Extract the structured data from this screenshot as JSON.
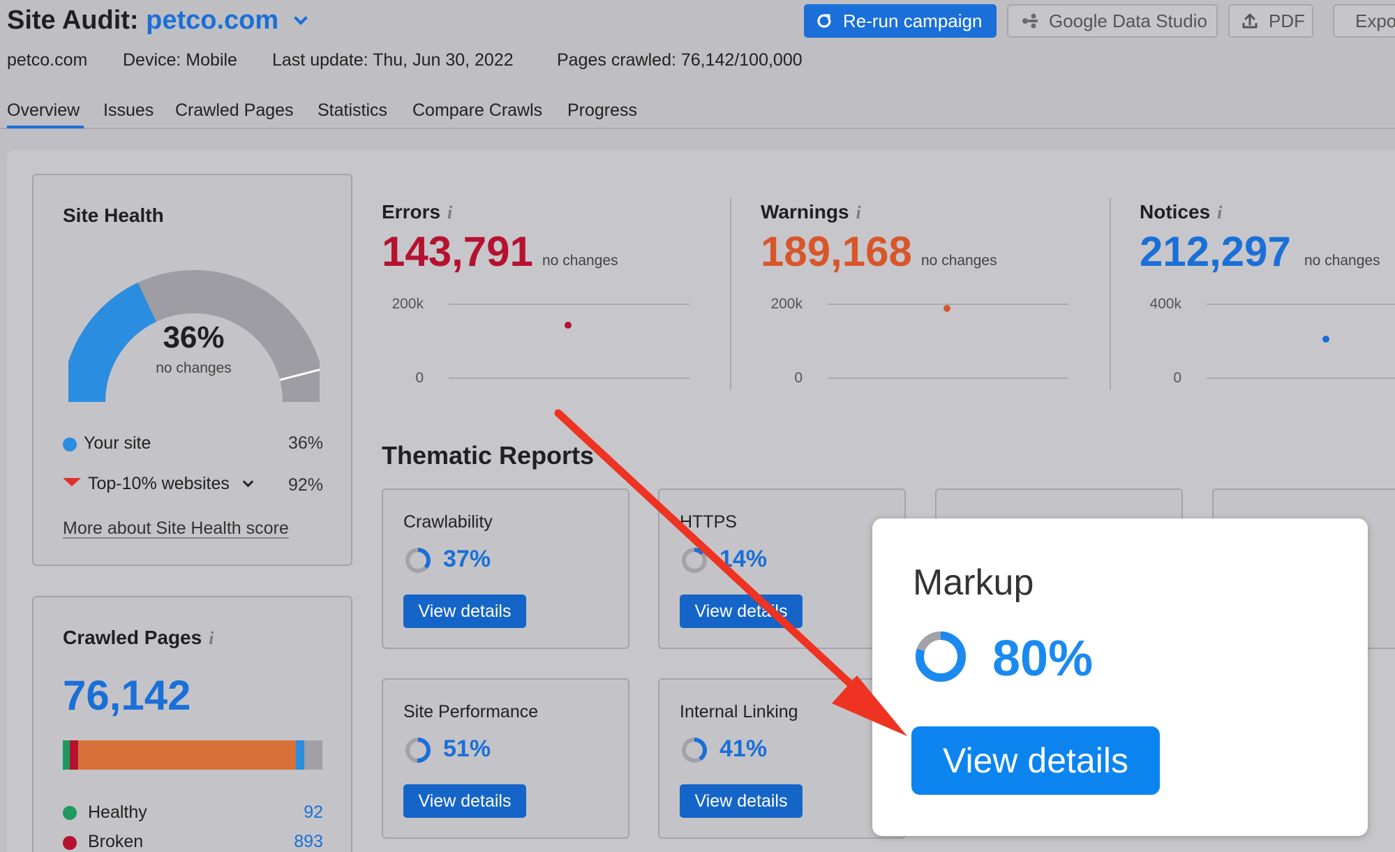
{
  "header": {
    "title_prefix": "Site Audit:",
    "title_domain": "petco.com",
    "meta": {
      "domain": "petco.com",
      "device": "Device: Mobile",
      "last_update": "Last update: Thu, Jun 30, 2022",
      "pages_crawled": "Pages crawled: 76,142/100,000"
    },
    "buttons": {
      "rerun": "Re-run campaign",
      "gds": "Google Data Studio",
      "pdf": "PDF",
      "export": "Export"
    }
  },
  "tabs": [
    "Overview",
    "Issues",
    "Crawled Pages",
    "Statistics",
    "Compare Crawls",
    "Progress"
  ],
  "site_health": {
    "title": "Site Health",
    "score_label": "36%",
    "score_value": 36,
    "sub": "no changes",
    "top_marker_value": 92,
    "legend": [
      {
        "label": "Your site",
        "value": "36%"
      },
      {
        "label": "Top-10% websites",
        "value": "92%"
      }
    ],
    "link": "More about Site Health score",
    "colors": {
      "your_site": "#2b8de0",
      "track": "#9d9da3",
      "marker": "#e0302a"
    }
  },
  "metrics": [
    {
      "title": "Errors",
      "value": "143,791",
      "change": "no changes",
      "color": "#b5122f",
      "chart_data": {
        "type": "scatter",
        "ytick_top": "200k",
        "ytick_bottom": "0",
        "ylim": [
          0,
          200000
        ],
        "points": [
          {
            "y": 143791
          }
        ]
      }
    },
    {
      "title": "Warnings",
      "value": "189,168",
      "change": "no changes",
      "color": "#d8562a",
      "chart_data": {
        "type": "scatter",
        "ytick_top": "200k",
        "ytick_bottom": "0",
        "ylim": [
          0,
          200000
        ],
        "points": [
          {
            "y": 189168
          }
        ]
      }
    },
    {
      "title": "Notices",
      "value": "212,297",
      "change": "no changes",
      "color": "#1a6fd8",
      "chart_data": {
        "type": "scatter",
        "ytick_top": "400k",
        "ytick_bottom": "0",
        "ylim": [
          0,
          400000
        ],
        "points": [
          {
            "y": 212297
          }
        ]
      }
    }
  ],
  "thematic": {
    "title": "Thematic Reports",
    "view_details": "View details",
    "cards": [
      {
        "title": "Crawlability",
        "pct": "37%",
        "value": 37
      },
      {
        "title": "HTTPS",
        "pct": "14%",
        "value": 14
      },
      {
        "title": "Site Performance",
        "pct": "51%",
        "value": 51
      },
      {
        "title": "Internal Linking",
        "pct": "41%",
        "value": 41
      }
    ]
  },
  "crawled_pages": {
    "title": "Crawled Pages",
    "total": "76,142",
    "legend": [
      {
        "label": "Healthy",
        "value": "92",
        "color": "#1f9a5e"
      },
      {
        "label": "Broken",
        "value": "893",
        "color": "#b5122f"
      }
    ],
    "bar_colors": [
      "#1f9a5e",
      "#b5122f",
      "#d8703a",
      "#2b8de0",
      "#a0a0a6"
    ]
  },
  "zoom": {
    "title": "Markup",
    "pct": "80%",
    "value": 80,
    "button": "View details"
  },
  "annotation": {
    "arrow_color": "#ee3322"
  }
}
